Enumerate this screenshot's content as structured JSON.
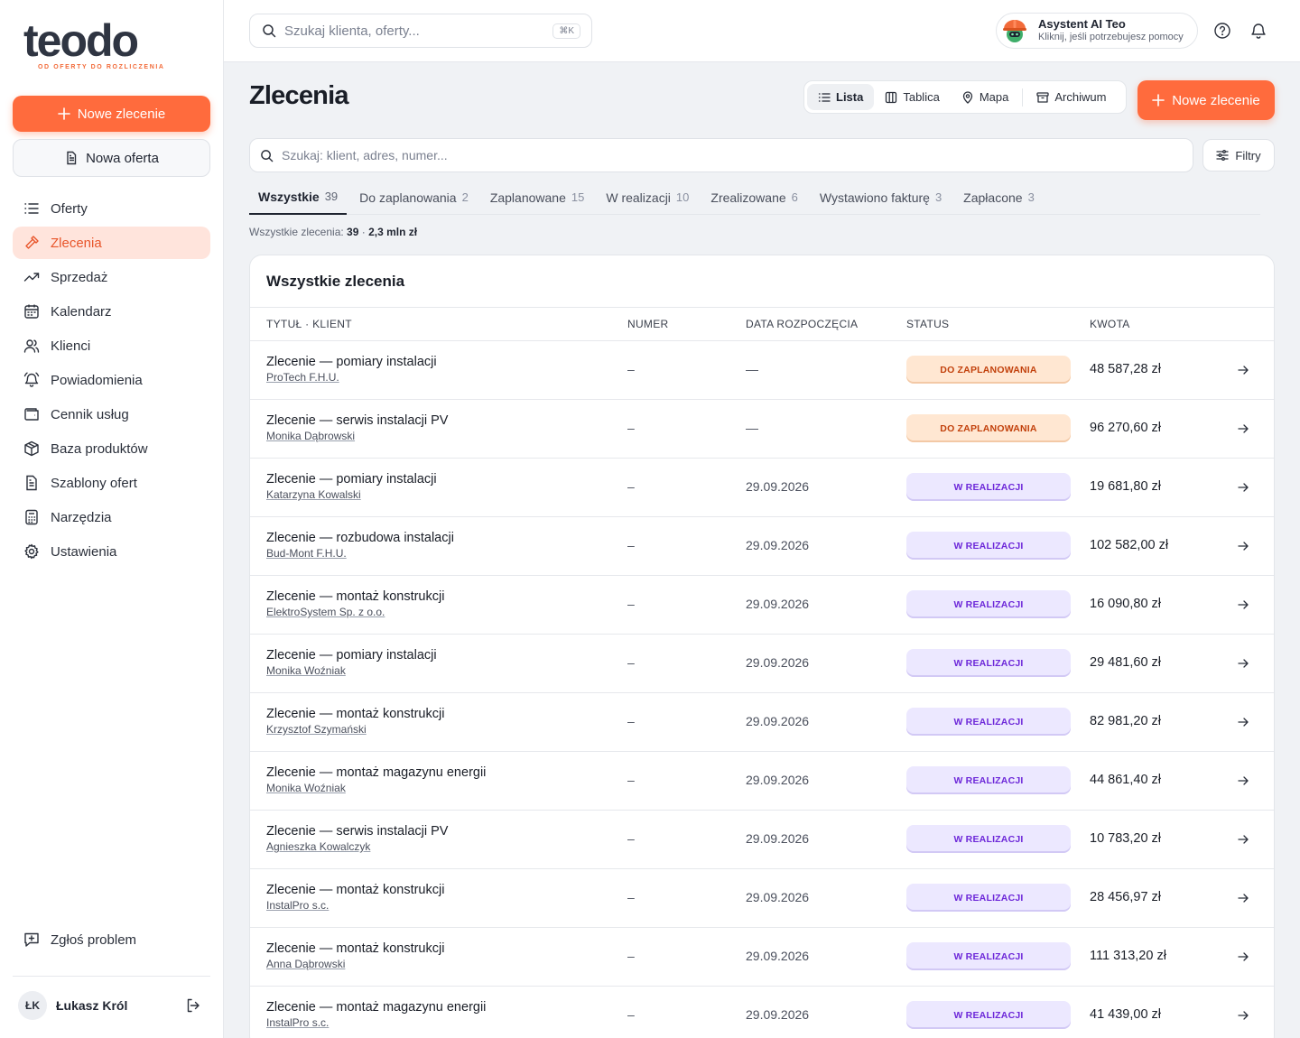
{
  "brand": {
    "name": "teodo",
    "tagline": "OD OFERTY DO ROZLICZENIA",
    "accent": "#ff6b3d"
  },
  "sidebar": {
    "new_order_label": "Nowe zlecenie",
    "new_offer_label": "Nowa oferta",
    "items": [
      {
        "label": "Oferty",
        "icon": "list-icon"
      },
      {
        "label": "Zlecenia",
        "icon": "hammer-icon"
      },
      {
        "label": "Sprzedaż",
        "icon": "trending-up-icon"
      },
      {
        "label": "Kalendarz",
        "icon": "calendar-icon"
      },
      {
        "label": "Klienci",
        "icon": "users-icon"
      },
      {
        "label": "Powiadomienia",
        "icon": "bell-ring-icon"
      },
      {
        "label": "Cennik usług",
        "icon": "wallet-icon"
      },
      {
        "label": "Baza produktów",
        "icon": "package-icon"
      },
      {
        "label": "Szablony ofert",
        "icon": "file-text-icon"
      },
      {
        "label": "Narzędzia",
        "icon": "calculator-icon"
      },
      {
        "label": "Ustawienia",
        "icon": "gear-icon"
      }
    ],
    "report_label": "Zgłoś problem",
    "user": {
      "initials": "ŁK",
      "name": "Łukasz Król"
    }
  },
  "topbar": {
    "search_placeholder": "Szukaj klienta, oferty...",
    "shortcut": "⌘K",
    "assistant_title": "Asystent AI Teo",
    "assistant_subtitle": "Kliknij, jeśli potrzebujesz pomocy"
  },
  "page": {
    "title": "Zlecenia",
    "views": [
      "Lista",
      "Tablica",
      "Mapa",
      "Archiwum"
    ],
    "new_button": "Nowe zlecenie",
    "search_placeholder": "Szukaj: klient, adres, numer...",
    "filters_label": "Filtry",
    "tabs": [
      {
        "label": "Wszystkie",
        "count": "39"
      },
      {
        "label": "Do zaplanowania",
        "count": "2"
      },
      {
        "label": "Zaplanowane",
        "count": "15"
      },
      {
        "label": "W realizacji",
        "count": "10"
      },
      {
        "label": "Zrealizowane",
        "count": "6"
      },
      {
        "label": "Wystawiono fakturę",
        "count": "3"
      },
      {
        "label": "Zapłacone",
        "count": "3"
      }
    ],
    "summary_label": "Wszystkie zlecenia:",
    "summary_count": "39",
    "summary_sep": " · ",
    "summary_value": "2,3 mln zł"
  },
  "table": {
    "title": "Wszystkie zlecenia",
    "headers": {
      "title_client": "TYTUŁ · KLIENT",
      "number": "NUMER",
      "start_date": "DATA ROZPOCZĘCIA",
      "status": "STATUS",
      "amount": "KWOTA"
    },
    "status_colors": {
      "plan_bg": "#ffe7d2",
      "plan_text": "#c2410c",
      "real_bg": "#ece8ff",
      "real_text": "#6d28d9"
    },
    "rows": [
      {
        "title": "Zlecenie — pomiary instalacji",
        "client": "ProTech F.H.U.",
        "number": "–",
        "date": "—",
        "status": "DO ZAPLANOWANIA",
        "status_kind": "plan",
        "amount": "48 587,28 zł"
      },
      {
        "title": "Zlecenie — serwis instalacji PV",
        "client": "Monika Dąbrowski",
        "number": "–",
        "date": "—",
        "status": "DO ZAPLANOWANIA",
        "status_kind": "plan",
        "amount": "96 270,60 zł"
      },
      {
        "title": "Zlecenie — pomiary instalacji",
        "client": "Katarzyna Kowalski",
        "number": "–",
        "date": "29.09.2026",
        "status": "W REALIZACJI",
        "status_kind": "real",
        "amount": "19 681,80 zł"
      },
      {
        "title": "Zlecenie — rozbudowa instalacji",
        "client": "Bud-Mont F.H.U.",
        "number": "–",
        "date": "29.09.2026",
        "status": "W REALIZACJI",
        "status_kind": "real",
        "amount": "102 582,00 zł"
      },
      {
        "title": "Zlecenie — montaż konstrukcji",
        "client": "ElektroSystem Sp. z o.o.",
        "number": "–",
        "date": "29.09.2026",
        "status": "W REALIZACJI",
        "status_kind": "real",
        "amount": "16 090,80 zł"
      },
      {
        "title": "Zlecenie — pomiary instalacji",
        "client": "Monika Woźniak",
        "number": "–",
        "date": "29.09.2026",
        "status": "W REALIZACJI",
        "status_kind": "real",
        "amount": "29 481,60 zł"
      },
      {
        "title": "Zlecenie — montaż konstrukcji",
        "client": "Krzysztof Szymański",
        "number": "–",
        "date": "29.09.2026",
        "status": "W REALIZACJI",
        "status_kind": "real",
        "amount": "82 981,20 zł"
      },
      {
        "title": "Zlecenie — montaż magazynu energii",
        "client": "Monika Woźniak",
        "number": "–",
        "date": "29.09.2026",
        "status": "W REALIZACJI",
        "status_kind": "real",
        "amount": "44 861,40 zł"
      },
      {
        "title": "Zlecenie — serwis instalacji PV",
        "client": "Agnieszka Kowalczyk",
        "number": "–",
        "date": "29.09.2026",
        "status": "W REALIZACJI",
        "status_kind": "real",
        "amount": "10 783,20 zł"
      },
      {
        "title": "Zlecenie — montaż konstrukcji",
        "client": "InstalPro s.c.",
        "number": "–",
        "date": "29.09.2026",
        "status": "W REALIZACJI",
        "status_kind": "real",
        "amount": "28 456,97 zł"
      },
      {
        "title": "Zlecenie — montaż konstrukcji",
        "client": "Anna Dąbrowski",
        "number": "–",
        "date": "29.09.2026",
        "status": "W REALIZACJI",
        "status_kind": "real",
        "amount": "111 313,20 zł"
      },
      {
        "title": "Zlecenie — montaż magazynu energii",
        "client": "InstalPro s.c.",
        "number": "–",
        "date": "29.09.2026",
        "status": "W REALIZACJI",
        "status_kind": "real",
        "amount": "41 439,00 zł"
      }
    ]
  }
}
